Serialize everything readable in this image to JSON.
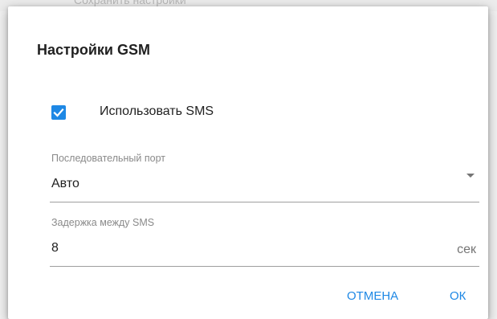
{
  "background": {
    "partial_text": "Сохранить настройки"
  },
  "dialog": {
    "title": "Настройки GSM",
    "use_sms": {
      "label": "Использовать SMS",
      "checked": true
    },
    "serial_port": {
      "label": "Последовательный порт",
      "value": "Авто",
      "icon": "dropdown-arrow-icon"
    },
    "sms_delay": {
      "label": "Задержка между SMS",
      "value": "8",
      "unit": "сек"
    },
    "buttons": {
      "cancel": "ОТМЕНА",
      "ok": "ОК"
    }
  },
  "colors": {
    "accent": "#1e88e5",
    "text": "#212121",
    "label": "#8a8a8a",
    "underline": "#9e9e9e"
  }
}
